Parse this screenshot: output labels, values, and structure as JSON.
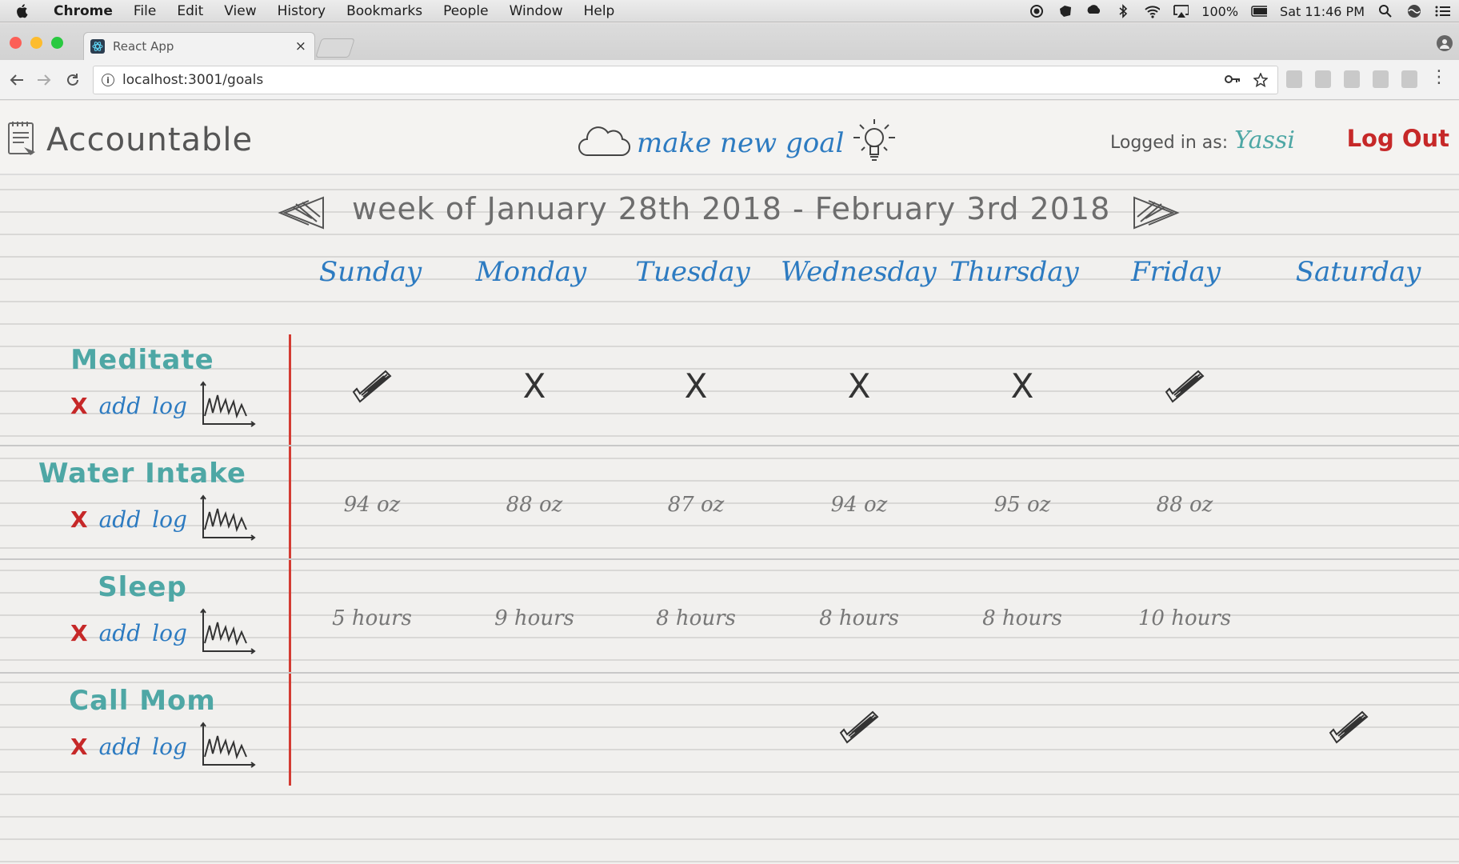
{
  "menubar": {
    "app": "Chrome",
    "items": [
      "File",
      "Edit",
      "View",
      "History",
      "Bookmarks",
      "People",
      "Window",
      "Help"
    ],
    "battery": "100%",
    "clock": "Sat 11:46 PM"
  },
  "browser": {
    "tab_title": "React App",
    "tab_close": "×",
    "url": "localhost:3001/goals"
  },
  "header": {
    "brand": "Accountable",
    "new_goal": "make new goal",
    "logged_in_label": "Logged in as:",
    "username": "Yassi",
    "logout": "Log Out"
  },
  "week": {
    "label": "week of January 28th 2018 - February 3rd 2018"
  },
  "days": [
    "Sunday",
    "Monday",
    "Tuesday",
    "Wednesday",
    "Thursday",
    "Friday",
    "Saturday"
  ],
  "goal_actions": {
    "delete": "X",
    "add": "add",
    "log": "log"
  },
  "goals": [
    {
      "name": "Meditate",
      "cells": [
        "check",
        "X",
        "X",
        "X",
        "X",
        "check",
        ""
      ]
    },
    {
      "name": "Water Intake",
      "cells": [
        "94 oz",
        "88 oz",
        "87 oz",
        "94 oz",
        "95 oz",
        "88 oz",
        ""
      ]
    },
    {
      "name": "Sleep",
      "cells": [
        "5 hours",
        "9 hours",
        "8 hours",
        "8 hours",
        "8 hours",
        "10 hours",
        ""
      ]
    },
    {
      "name": "Call Mom",
      "cells": [
        "",
        "",
        "",
        "check",
        "",
        "",
        "check"
      ]
    }
  ],
  "colors": {
    "accent_blue": "#2d7bc1",
    "teal": "#4ea7a5",
    "red": "#c62828",
    "margin_line": "#d33b32"
  }
}
